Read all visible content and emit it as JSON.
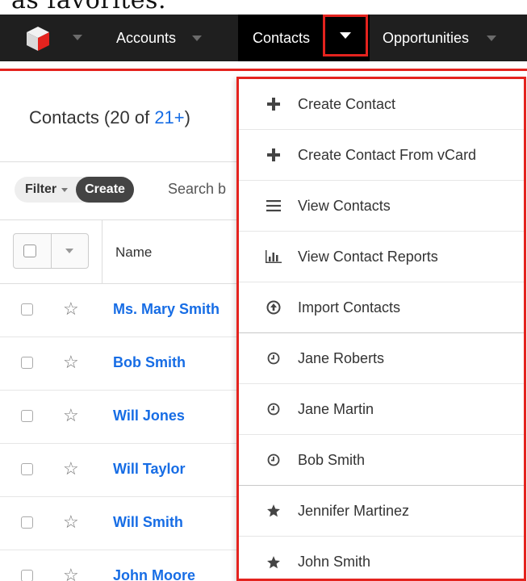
{
  "caption": "as favorites.",
  "navbar": {
    "tabs": [
      {
        "label": "Accounts"
      },
      {
        "label": "Contacts"
      },
      {
        "label": "Opportunities"
      }
    ]
  },
  "list": {
    "title_prefix": "Contacts (20 of ",
    "title_count": "21+",
    "title_suffix": ")",
    "filter_label": "Filter",
    "create_label": "Create",
    "search_placeholder": "Search b",
    "column_name": "Name",
    "rows": [
      {
        "name": "Ms. Mary Smith"
      },
      {
        "name": "Bob Smith"
      },
      {
        "name": "Will Jones"
      },
      {
        "name": "Will Taylor"
      },
      {
        "name": "Will Smith"
      },
      {
        "name": "John Moore"
      }
    ]
  },
  "dropdown": {
    "items": [
      {
        "label": "Create Contact",
        "icon": "plus-icon"
      },
      {
        "label": "Create Contact From vCard",
        "icon": "plus-icon"
      },
      {
        "label": "View Contacts",
        "icon": "list-icon"
      },
      {
        "label": "View Contact Reports",
        "icon": "bar-chart-icon"
      },
      {
        "label": "Import Contacts",
        "icon": "upload-icon"
      },
      {
        "label": "Jane Roberts",
        "icon": "clock-icon"
      },
      {
        "label": "Jane Martin",
        "icon": "clock-icon"
      },
      {
        "label": "Bob Smith",
        "icon": "clock-icon"
      },
      {
        "label": "Jennifer Martinez",
        "icon": "star-icon"
      },
      {
        "label": "John Smith",
        "icon": "star-icon"
      }
    ]
  },
  "colors": {
    "highlight_red": "#e4231e",
    "link_blue": "#176de5",
    "navbar_bg": "#1f1f1f"
  }
}
